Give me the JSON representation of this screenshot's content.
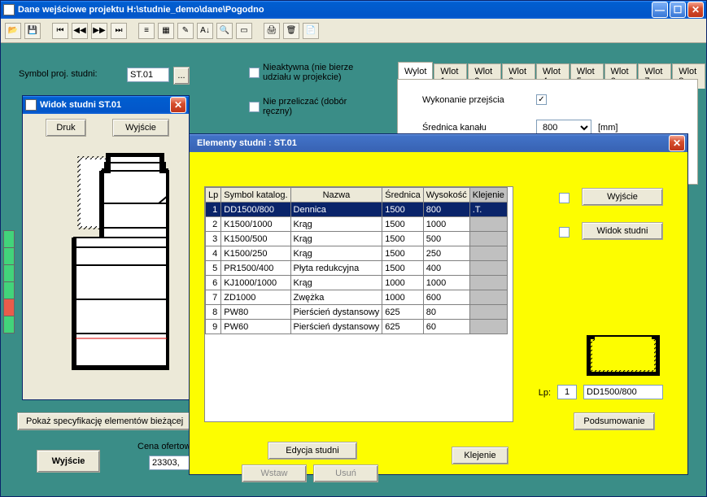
{
  "main": {
    "title": "Dane wejściowe projektu H:\\studnie_demo\\dane\\Pogodno",
    "symbol_label": "Symbol proj. studni:",
    "symbol_value": "ST.01",
    "chk_inactive": "Nieaktywna (nie bierze udziału w projekcie)",
    "chk_norecalc": "Nie przeliczać (dobór ręczny)",
    "spec_btn": "Pokaż specyfikację elementów bieżącej",
    "exit": "Wyjście",
    "price_label": "Cena ofertowa",
    "price_value": "23303,"
  },
  "tabs": [
    "Wylot",
    "Wlot 1",
    "Wlot 2",
    "Wlot 3",
    "Wlot 4",
    "Wlot 5",
    "Wlot 6",
    "Wlot 7",
    "Wlot 8"
  ],
  "panel": {
    "wykonanie": "Wykonanie przejścia",
    "srednica": "Średnica kanału",
    "srednica_val": "800",
    "mm": "[mm]"
  },
  "colors": [
    "#42d47a",
    "#42d47a",
    "#42d47a",
    "#42d47a",
    "#e95c4b",
    "#42d47a"
  ],
  "wview": {
    "title": "Widok studni ST.01",
    "druk": "Druk",
    "wyjscie": "Wyjście"
  },
  "welem": {
    "title": "Elementy studni :    ST.01",
    "cols": [
      "Lp",
      "Symbol katalog.",
      "Nazwa",
      "Średnica",
      "Wysokość",
      "Klejenie"
    ],
    "rows": [
      [
        "1",
        "DD1500/800",
        "Dennica",
        "1500",
        "800",
        ".T."
      ],
      [
        "2",
        "K1500/1000",
        "Krąg",
        "1500",
        "1000",
        ""
      ],
      [
        "3",
        "K1500/500",
        "Krąg",
        "1500",
        "500",
        ""
      ],
      [
        "4",
        "K1500/250",
        "Krąg",
        "1500",
        "250",
        ""
      ],
      [
        "5",
        "PR1500/400",
        "Płyta redukcyjna",
        "1500",
        "400",
        ""
      ],
      [
        "6",
        "KJ1000/1000",
        "Krąg",
        "1000",
        "1000",
        ""
      ],
      [
        "7",
        "ZD1000",
        "Zwężka",
        "1000",
        "600",
        ""
      ],
      [
        "8",
        "PW80",
        "Pierścień dystansowy",
        "625",
        "80",
        ""
      ],
      [
        "9",
        "PW60",
        "Pierścień dystansowy",
        "625",
        "60",
        ""
      ]
    ],
    "wyjscie": "Wyjście",
    "widok": "Widok studni",
    "lp": "Lp:",
    "lp_val": "1",
    "sym_val": "DD1500/800",
    "pods": "Podsumowanie",
    "edycja": "Edycja studni",
    "wstaw": "Wstaw",
    "usun": "Usuń",
    "klejenie": "Klejenie"
  }
}
